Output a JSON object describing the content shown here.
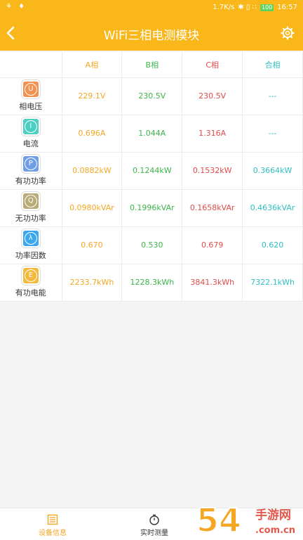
{
  "status_bar": {
    "left_icons": "⚘ ♦",
    "speed": "1.7K/s",
    "right_icons": "✱ ▯ ∷",
    "battery": "100",
    "time": "16:57"
  },
  "header": {
    "title": "WiFi三相电测模块",
    "colors": {
      "bar": "#f9b719"
    }
  },
  "table": {
    "columns": [
      {
        "label": "A相",
        "color": "#f5a623"
      },
      {
        "label": "B相",
        "color": "#3bb54a"
      },
      {
        "label": "C相",
        "color": "#e24a4a"
      },
      {
        "label": "合相",
        "color": "#2fbfbf"
      }
    ],
    "rows": [
      {
        "icon": "U",
        "icon_color": "#f39152",
        "name": "相电压",
        "values": [
          "229.1V",
          "230.5V",
          "230.5V",
          "---"
        ]
      },
      {
        "icon": "I",
        "icon_color": "#4dd0c4",
        "name": "电流",
        "values": [
          "0.696A",
          "1.044A",
          "1.316A",
          "---"
        ]
      },
      {
        "icon": "P",
        "icon_color": "#6f9ee6",
        "name": "有功功率",
        "values": [
          "0.0882kW",
          "0.1244kW",
          "0.1532kW",
          "0.3664kW"
        ]
      },
      {
        "icon": "Q",
        "icon_color": "#b9ab78",
        "name": "无功功率",
        "values": [
          "0.0980kVAr",
          "0.1996kVAr",
          "0.1658kVAr",
          "0.4636kVAr"
        ]
      },
      {
        "icon": "λ",
        "icon_color": "#3aa7f0",
        "name": "功率因数",
        "values": [
          "0.670",
          "0.530",
          "0.679",
          "0.620"
        ]
      },
      {
        "icon": "E",
        "icon_color": "#f4b83a",
        "name": "有功电能",
        "values": [
          "2233.7kWh",
          "1228.3kWh",
          "3841.3kWh",
          "7322.1kWh"
        ]
      }
    ]
  },
  "bottom_nav": {
    "tabs": [
      {
        "label": "设备信息",
        "active": true,
        "color": "#f5a623"
      },
      {
        "label": "实时测量",
        "active": false,
        "color": "#333333"
      }
    ]
  },
  "watermark": {
    "text1": "54",
    "text2": "手游网",
    "text3": ".com.cn"
  }
}
